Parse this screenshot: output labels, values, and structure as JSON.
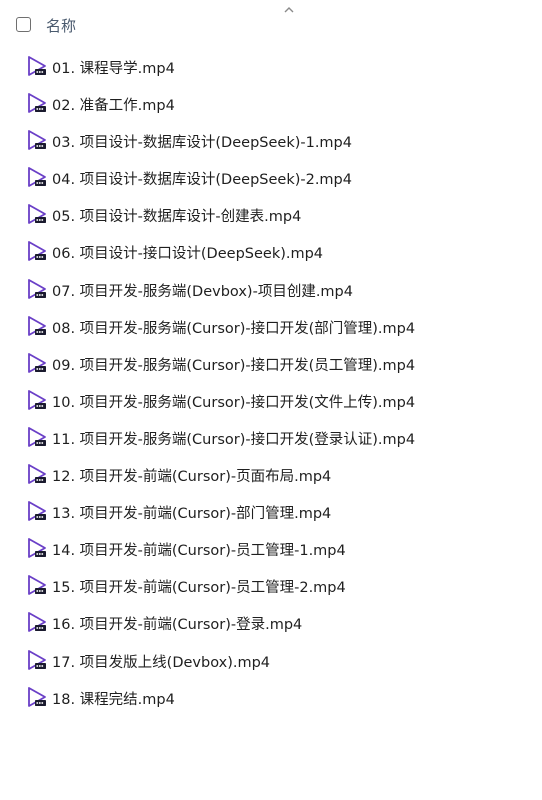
{
  "header": {
    "checkbox_checked": false,
    "column_name": "名称",
    "sort_icon": "chevron-up-icon"
  },
  "files": [
    {
      "name": "01. 课程导学.mp4",
      "icon": "video-file-icon"
    },
    {
      "name": "02. 准备工作.mp4",
      "icon": "video-file-icon"
    },
    {
      "name": "03. 项目设计-数据库设计(DeepSeek)-1.mp4",
      "icon": "video-file-icon"
    },
    {
      "name": "04. 项目设计-数据库设计(DeepSeek)-2.mp4",
      "icon": "video-file-icon"
    },
    {
      "name": "05. 项目设计-数据库设计-创建表.mp4",
      "icon": "video-file-icon"
    },
    {
      "name": "06. 项目设计-接口设计(DeepSeek).mp4",
      "icon": "video-file-icon"
    },
    {
      "name": "07. 项目开发-服务端(Devbox)-项目创建.mp4",
      "icon": "video-file-icon"
    },
    {
      "name": "08. 项目开发-服务端(Cursor)-接口开发(部门管理).mp4",
      "icon": "video-file-icon"
    },
    {
      "name": "09. 项目开发-服务端(Cursor)-接口开发(员工管理).mp4",
      "icon": "video-file-icon"
    },
    {
      "name": "10. 项目开发-服务端(Cursor)-接口开发(文件上传).mp4",
      "icon": "video-file-icon"
    },
    {
      "name": "11. 项目开发-服务端(Cursor)-接口开发(登录认证).mp4",
      "icon": "video-file-icon"
    },
    {
      "name": "12. 项目开发-前端(Cursor)-页面布局.mp4",
      "icon": "video-file-icon"
    },
    {
      "name": "13. 项目开发-前端(Cursor)-部门管理.mp4",
      "icon": "video-file-icon"
    },
    {
      "name": "14. 项目开发-前端(Cursor)-员工管理-1.mp4",
      "icon": "video-file-icon"
    },
    {
      "name": "15. 项目开发-前端(Cursor)-员工管理-2.mp4",
      "icon": "video-file-icon"
    },
    {
      "name": "16. 项目开发-前端(Cursor)-登录.mp4",
      "icon": "video-file-icon"
    },
    {
      "name": "17. 项目发版上线(Devbox).mp4",
      "icon": "video-file-icon"
    },
    {
      "name": "18. 课程完结.mp4",
      "icon": "video-file-icon"
    }
  ],
  "colors": {
    "icon_accent": "#6a3fc7",
    "icon_badge": "#1a1a2e",
    "header_text": "#4a5a6e",
    "file_text": "#1f1f1f"
  }
}
